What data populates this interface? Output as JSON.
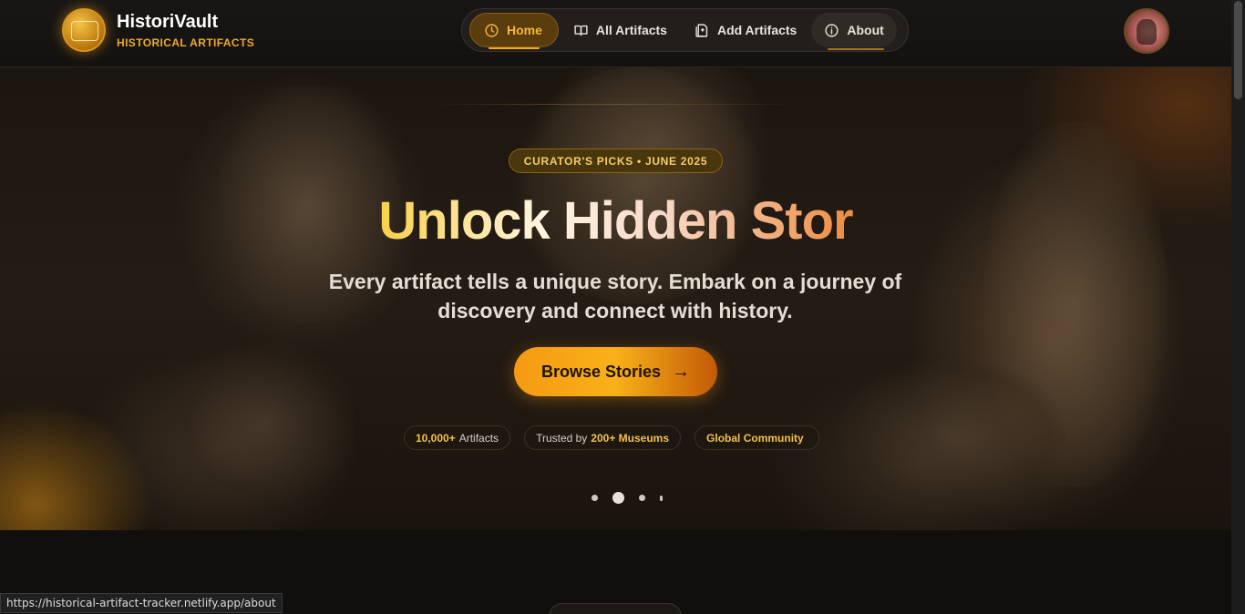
{
  "brand": {
    "name": "HistoriVault",
    "subtitle": "HISTORICAL ARTIFACTS"
  },
  "nav": {
    "items": [
      {
        "label": "Home",
        "icon": "clock-icon",
        "active": true
      },
      {
        "label": "All Artifacts",
        "icon": "book-open-icon",
        "active": false
      },
      {
        "label": "Add Artifacts",
        "icon": "document-plus-icon",
        "active": false
      },
      {
        "label": "About",
        "icon": "info-icon",
        "active": false
      }
    ]
  },
  "hero": {
    "badge": "CURATOR'S PICKS • JUNE 2025",
    "headline": "Unlock Hidden Stor",
    "subtitle": "Every artifact tells a unique story. Embark on a journey of discovery and connect with history.",
    "cta_label": "Browse Stories",
    "stats": [
      {
        "highlight": "10,000+",
        "text": "Artifacts",
        "after": ""
      },
      {
        "highlight": "",
        "text": "Trusted by",
        "after": "200+ Museums"
      },
      {
        "highlight": "Global Community",
        "text": "",
        "after": ""
      }
    ],
    "carousel_active_index": 1,
    "carousel_count": 4
  },
  "status_bar": {
    "url": "https://historical-artifact-tracker.netlify.app/about"
  },
  "colors": {
    "accent": "#f5a623",
    "gold": "#f2c14a",
    "background": "#0f0d0b"
  }
}
